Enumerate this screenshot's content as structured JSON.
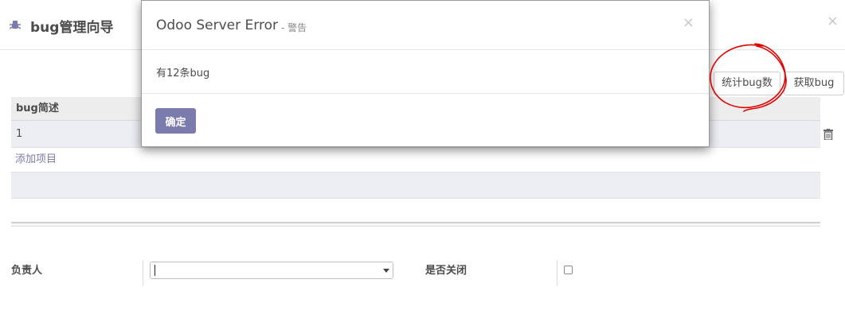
{
  "wizard": {
    "title": "bug管理向导",
    "close_glyph": "×",
    "buttons": {
      "count": "统计bug数",
      "get": "获取bug"
    },
    "table": {
      "header": "bug简述",
      "rows": [
        "1"
      ],
      "add_item": "添加项目"
    },
    "form": {
      "owner_label": "负责人",
      "owner_value": "",
      "closed_label": "是否关闭",
      "closed_checked": false
    }
  },
  "dialog": {
    "title": "Odoo Server Error",
    "subtitle": "- 警告",
    "close_glyph": "×",
    "message": "有12条bug",
    "ok_label": "确定"
  },
  "colors": {
    "primary": "#7c7bad",
    "annotation": "#e00000"
  },
  "icons": {
    "wizard": "bug-icon",
    "row_delete": "trash-icon"
  }
}
